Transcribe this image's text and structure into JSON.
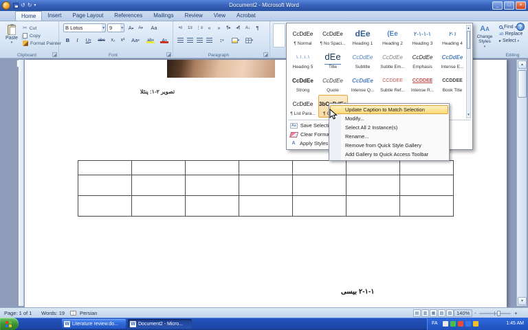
{
  "window": {
    "title": "Document2 - Microsoft Word",
    "minimize": "_",
    "maximize": "□",
    "close": "×"
  },
  "tabs": [
    {
      "label": "Home",
      "active": true
    },
    {
      "label": "Insert"
    },
    {
      "label": "Page Layout"
    },
    {
      "label": "References"
    },
    {
      "label": "Mailings"
    },
    {
      "label": "Review"
    },
    {
      "label": "View"
    },
    {
      "label": "Acrobat"
    }
  ],
  "ribbon": {
    "clipboard": {
      "group": "Clipboard",
      "paste": "Paste",
      "cut": "Cut",
      "copy": "Copy",
      "format_painter": "Format Painter"
    },
    "font": {
      "group": "Font",
      "name": "B Lotus",
      "size": "9",
      "bold": "B",
      "italic": "I",
      "underline": "U",
      "strike": "abc",
      "subscript": "x₂",
      "superscript": "x²",
      "change_case": "Aa",
      "highlight": "ab",
      "font_color": "A",
      "grow": "A",
      "shrink": "A",
      "clear": "Aa"
    },
    "paragraph": {
      "group": "Paragraph"
    },
    "styles": {
      "change_styles": "Change Styles"
    },
    "editing": {
      "group": "Editing",
      "find": "Find",
      "replace": "Replace",
      "select": "Select"
    }
  },
  "styles_gallery": {
    "items": [
      {
        "kind": "normal",
        "sample": "CcDdEe",
        "label": "¶ Normal"
      },
      {
        "kind": "normal",
        "sample": "CcDdEe",
        "label": "¶ No Spaci..."
      },
      {
        "kind": "h1",
        "sample": "dEe",
        "label": "Heading 1"
      },
      {
        "kind": "h2",
        "sample": "(Ee",
        "label": "Heading 2"
      },
      {
        "kind": "h3",
        "sample": "۲-۱-۱-۱",
        "label": "Heading 3"
      },
      {
        "kind": "h4",
        "sample": "۲-۱",
        "label": "Heading 4"
      },
      {
        "kind": "h5",
        "sample": "۱.۱.۱.۱",
        "label": "Heading 5"
      },
      {
        "kind": "title",
        "sample": "dEe",
        "label": "Title"
      },
      {
        "kind": "subtitle",
        "sample": "CcDdEe",
        "label": "Subtitle"
      },
      {
        "kind": "subtle",
        "sample": "CcDdEe",
        "label": "Subtle Em..."
      },
      {
        "kind": "emph",
        "sample": "CcDdEe",
        "label": "Emphasis"
      },
      {
        "kind": "intense-e",
        "sample": "CcDdEe",
        "label": "Intense E..."
      },
      {
        "kind": "strong",
        "sample": "CcDdEe",
        "label": "Strong"
      },
      {
        "kind": "quote",
        "sample": "CcDdEe",
        "label": "Quote"
      },
      {
        "kind": "iq",
        "sample": "CcDdEe",
        "label": "Intense Q..."
      },
      {
        "kind": "sref",
        "sample": "CCDDEE",
        "label": "Subtle Ref..."
      },
      {
        "kind": "iref",
        "sample": "CCDDEE",
        "label": "Intense R..."
      },
      {
        "kind": "book",
        "sample": "CCDDEE",
        "label": "Book Title"
      },
      {
        "kind": "listp",
        "sample": "CcDdEe",
        "label": "¶ List Para..."
      },
      {
        "kind": "caption",
        "sample": "3bCcDdEe",
        "label": "¶ Caption",
        "selected": true
      }
    ],
    "footer": [
      {
        "icon": "save-style-icon",
        "label": "Save Selection as a New Quick Style..."
      },
      {
        "icon": "eraser-icon",
        "label": "Clear Formatting"
      },
      {
        "icon": "apply-styles-icon",
        "label": "Apply Styles..."
      }
    ]
  },
  "context_menu": {
    "items": [
      {
        "label": "Update Caption to Match Selection",
        "highlighted": true
      },
      {
        "label": "Modify..."
      },
      {
        "label": "Select All 2 Instance(s)"
      },
      {
        "label": "Rename..."
      },
      {
        "label": "Remove from Quick Style Gallery"
      },
      {
        "label": "Add Gallery to Quick Access Toolbar"
      }
    ]
  },
  "document": {
    "caption": "تصویر ۲-۱: پنئلا",
    "heading": "۲-۱-۱ بیسی",
    "table": {
      "rows": 3,
      "cols": 7
    }
  },
  "status_bar": {
    "page": "Page: 1 of 1",
    "words": "Words: 19",
    "language": "Persian",
    "zoom": "140%"
  },
  "taskbar": {
    "buttons": [
      {
        "label": "Literature review.do..."
      },
      {
        "label": "Document2 - Micro...",
        "active": true
      }
    ],
    "language": "FA",
    "time": "1:45 AM"
  }
}
